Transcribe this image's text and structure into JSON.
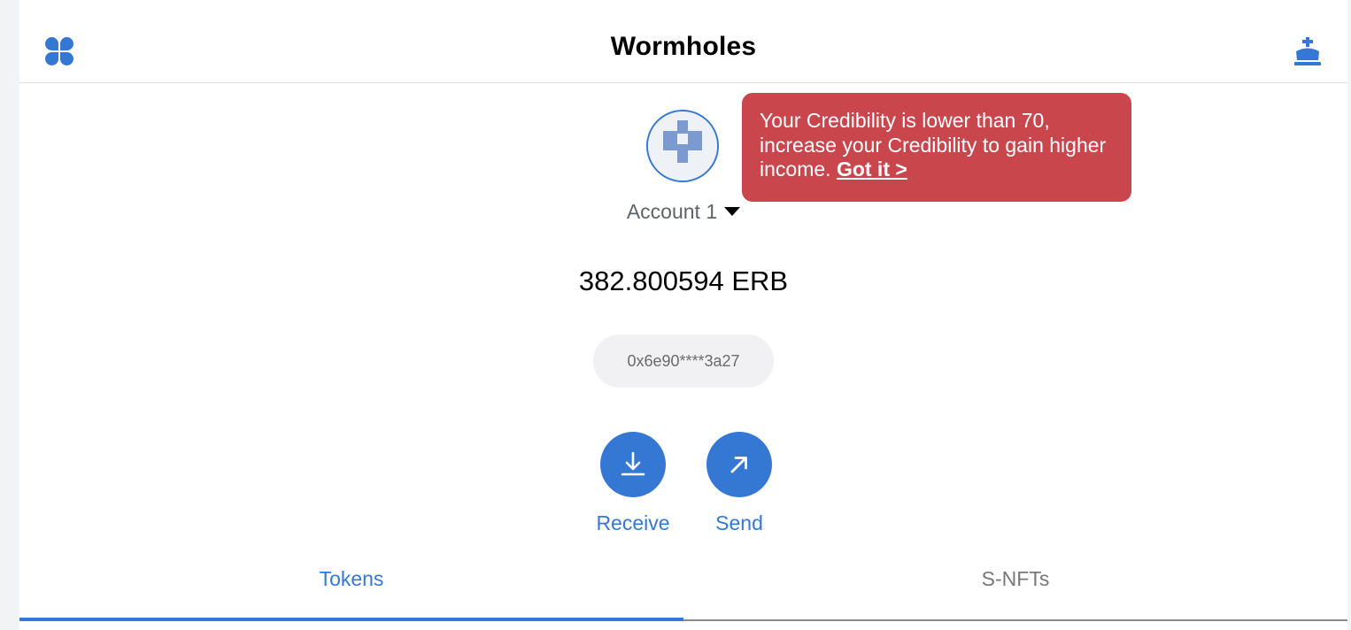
{
  "header": {
    "title": "Wormholes",
    "menu_icon": "four-petal-grid-icon",
    "right_icon": "crown-icon"
  },
  "account": {
    "avatar_icon": "pixel-identicon",
    "name": "Account 1",
    "balance": "382.800594 ERB",
    "address": "0x6e90****3a27"
  },
  "tooltip": {
    "message": "Your Credibility is lower than 70, increase your Credibility to gain higher income.",
    "link_label": "Got it >"
  },
  "actions": {
    "receive_label": "Receive",
    "send_label": "Send"
  },
  "tabs": [
    {
      "label": "Tokens",
      "active": true
    },
    {
      "label": "S-NFTs",
      "active": false
    }
  ],
  "colors": {
    "accent": "#3478d4",
    "tooltip_bg": "#c9464d",
    "pill_bg": "#f1f1f3"
  }
}
